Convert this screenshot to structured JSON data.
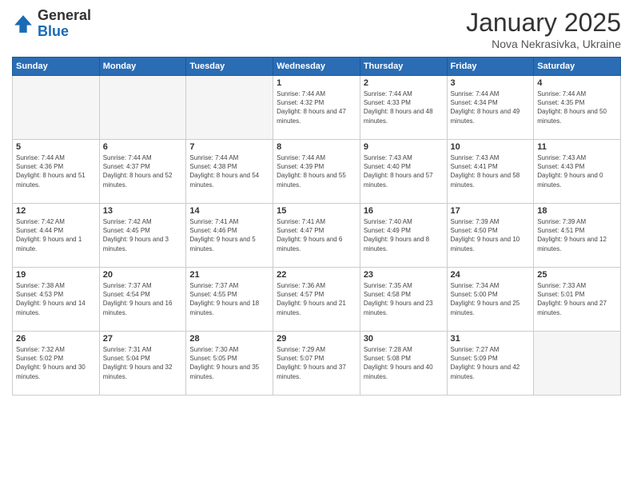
{
  "logo": {
    "general": "General",
    "blue": "Blue"
  },
  "header": {
    "title": "January 2025",
    "subtitle": "Nova Nekrasivka, Ukraine"
  },
  "weekdays": [
    "Sunday",
    "Monday",
    "Tuesday",
    "Wednesday",
    "Thursday",
    "Friday",
    "Saturday"
  ],
  "weeks": [
    [
      {
        "day": "",
        "info": ""
      },
      {
        "day": "",
        "info": ""
      },
      {
        "day": "",
        "info": ""
      },
      {
        "day": "1",
        "info": "Sunrise: 7:44 AM\nSunset: 4:32 PM\nDaylight: 8 hours and 47 minutes."
      },
      {
        "day": "2",
        "info": "Sunrise: 7:44 AM\nSunset: 4:33 PM\nDaylight: 8 hours and 48 minutes."
      },
      {
        "day": "3",
        "info": "Sunrise: 7:44 AM\nSunset: 4:34 PM\nDaylight: 8 hours and 49 minutes."
      },
      {
        "day": "4",
        "info": "Sunrise: 7:44 AM\nSunset: 4:35 PM\nDaylight: 8 hours and 50 minutes."
      }
    ],
    [
      {
        "day": "5",
        "info": "Sunrise: 7:44 AM\nSunset: 4:36 PM\nDaylight: 8 hours and 51 minutes."
      },
      {
        "day": "6",
        "info": "Sunrise: 7:44 AM\nSunset: 4:37 PM\nDaylight: 8 hours and 52 minutes."
      },
      {
        "day": "7",
        "info": "Sunrise: 7:44 AM\nSunset: 4:38 PM\nDaylight: 8 hours and 54 minutes."
      },
      {
        "day": "8",
        "info": "Sunrise: 7:44 AM\nSunset: 4:39 PM\nDaylight: 8 hours and 55 minutes."
      },
      {
        "day": "9",
        "info": "Sunrise: 7:43 AM\nSunset: 4:40 PM\nDaylight: 8 hours and 57 minutes."
      },
      {
        "day": "10",
        "info": "Sunrise: 7:43 AM\nSunset: 4:41 PM\nDaylight: 8 hours and 58 minutes."
      },
      {
        "day": "11",
        "info": "Sunrise: 7:43 AM\nSunset: 4:43 PM\nDaylight: 9 hours and 0 minutes."
      }
    ],
    [
      {
        "day": "12",
        "info": "Sunrise: 7:42 AM\nSunset: 4:44 PM\nDaylight: 9 hours and 1 minute."
      },
      {
        "day": "13",
        "info": "Sunrise: 7:42 AM\nSunset: 4:45 PM\nDaylight: 9 hours and 3 minutes."
      },
      {
        "day": "14",
        "info": "Sunrise: 7:41 AM\nSunset: 4:46 PM\nDaylight: 9 hours and 5 minutes."
      },
      {
        "day": "15",
        "info": "Sunrise: 7:41 AM\nSunset: 4:47 PM\nDaylight: 9 hours and 6 minutes."
      },
      {
        "day": "16",
        "info": "Sunrise: 7:40 AM\nSunset: 4:49 PM\nDaylight: 9 hours and 8 minutes."
      },
      {
        "day": "17",
        "info": "Sunrise: 7:39 AM\nSunset: 4:50 PM\nDaylight: 9 hours and 10 minutes."
      },
      {
        "day": "18",
        "info": "Sunrise: 7:39 AM\nSunset: 4:51 PM\nDaylight: 9 hours and 12 minutes."
      }
    ],
    [
      {
        "day": "19",
        "info": "Sunrise: 7:38 AM\nSunset: 4:53 PM\nDaylight: 9 hours and 14 minutes."
      },
      {
        "day": "20",
        "info": "Sunrise: 7:37 AM\nSunset: 4:54 PM\nDaylight: 9 hours and 16 minutes."
      },
      {
        "day": "21",
        "info": "Sunrise: 7:37 AM\nSunset: 4:55 PM\nDaylight: 9 hours and 18 minutes."
      },
      {
        "day": "22",
        "info": "Sunrise: 7:36 AM\nSunset: 4:57 PM\nDaylight: 9 hours and 21 minutes."
      },
      {
        "day": "23",
        "info": "Sunrise: 7:35 AM\nSunset: 4:58 PM\nDaylight: 9 hours and 23 minutes."
      },
      {
        "day": "24",
        "info": "Sunrise: 7:34 AM\nSunset: 5:00 PM\nDaylight: 9 hours and 25 minutes."
      },
      {
        "day": "25",
        "info": "Sunrise: 7:33 AM\nSunset: 5:01 PM\nDaylight: 9 hours and 27 minutes."
      }
    ],
    [
      {
        "day": "26",
        "info": "Sunrise: 7:32 AM\nSunset: 5:02 PM\nDaylight: 9 hours and 30 minutes."
      },
      {
        "day": "27",
        "info": "Sunrise: 7:31 AM\nSunset: 5:04 PM\nDaylight: 9 hours and 32 minutes."
      },
      {
        "day": "28",
        "info": "Sunrise: 7:30 AM\nSunset: 5:05 PM\nDaylight: 9 hours and 35 minutes."
      },
      {
        "day": "29",
        "info": "Sunrise: 7:29 AM\nSunset: 5:07 PM\nDaylight: 9 hours and 37 minutes."
      },
      {
        "day": "30",
        "info": "Sunrise: 7:28 AM\nSunset: 5:08 PM\nDaylight: 9 hours and 40 minutes."
      },
      {
        "day": "31",
        "info": "Sunrise: 7:27 AM\nSunset: 5:09 PM\nDaylight: 9 hours and 42 minutes."
      },
      {
        "day": "",
        "info": ""
      }
    ]
  ]
}
